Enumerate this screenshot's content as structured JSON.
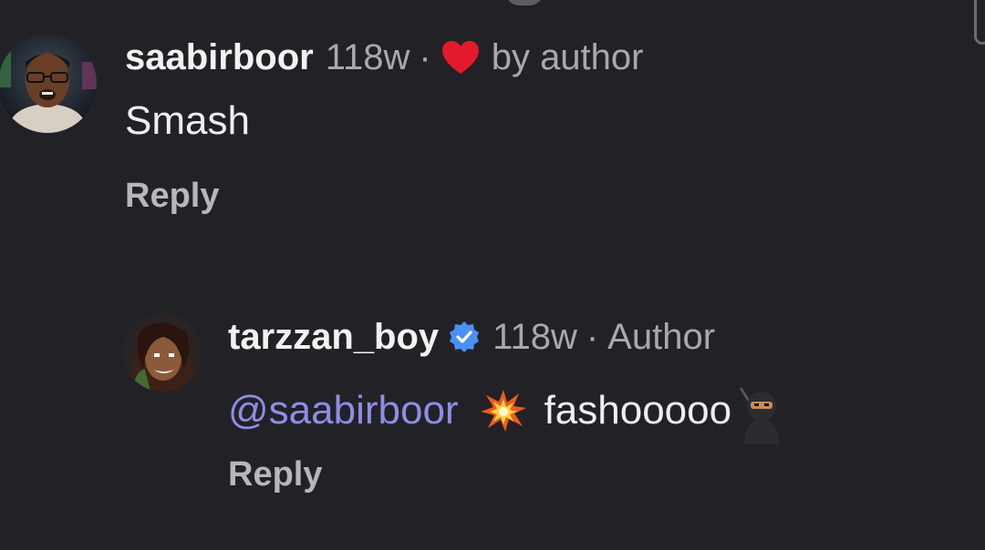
{
  "comments": [
    {
      "username": "saabirboor",
      "time": "118w",
      "separator": "·",
      "liked_label": "by author",
      "text": "Smash",
      "reply_label": "Reply"
    },
    {
      "username": "tarzzan_boy",
      "time": "118w",
      "separator": "·",
      "author_label": "Author",
      "mention": "@saabirboor",
      "text": "fashooooo",
      "reply_label": "Reply"
    }
  ],
  "icons": {
    "heart": "heart-icon",
    "verified": "verified-badge-icon",
    "burst": "collision-emoji",
    "ninja": "ninja-emoji"
  },
  "colors": {
    "background": "#222226",
    "mention": "#8e8de7",
    "heart": "#e5192c",
    "verified": "#4a90f5"
  }
}
